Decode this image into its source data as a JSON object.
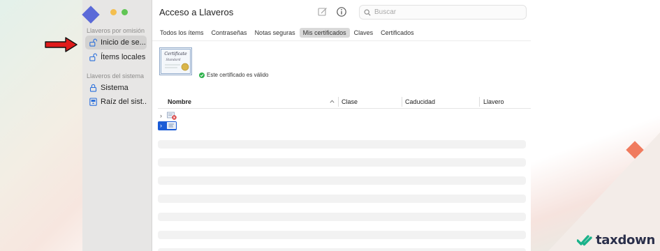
{
  "window": {
    "title": "Acceso a Llaveros",
    "search_placeholder": "Buscar"
  },
  "sidebar": {
    "section_default": "Llaveros por omisión",
    "items_default": [
      {
        "label": "Inicio de se...",
        "icon": "lock-open-icon",
        "selected": true
      },
      {
        "label": "Ítems locales",
        "icon": "lock-open-icon",
        "selected": false
      }
    ],
    "section_system": "Llaveros del sistema",
    "items_system": [
      {
        "label": "Sistema",
        "icon": "lock-icon",
        "selected": false
      },
      {
        "label": "Raíz del sist...",
        "icon": "cabinet-icon",
        "selected": false
      }
    ]
  },
  "tabs": [
    {
      "label": "Todos los ítems",
      "active": false
    },
    {
      "label": "Contraseñas",
      "active": false
    },
    {
      "label": "Notas seguras",
      "active": false
    },
    {
      "label": "Mis certificados",
      "active": true
    },
    {
      "label": "Claves",
      "active": false
    },
    {
      "label": "Certificados",
      "active": false
    }
  ],
  "certificate": {
    "image_text_title": "Certificate",
    "image_text_sub": "Standard",
    "status": "Este certificado es válido",
    "status_color": "#2fb24c"
  },
  "table": {
    "columns": [
      "Nombre",
      "Clase",
      "Caducidad",
      "Llavero"
    ],
    "rows": [
      {
        "icon": "certificate-error-icon",
        "selected": false
      },
      {
        "icon": "certificate-icon",
        "selected": true
      }
    ]
  },
  "brand": {
    "name": "taxdown",
    "accent": "#1bb28a"
  },
  "colors": {
    "selection": "#1a5bd6",
    "sidebar_bg": "#e7e6e5",
    "arrow": "#e01b1b"
  }
}
